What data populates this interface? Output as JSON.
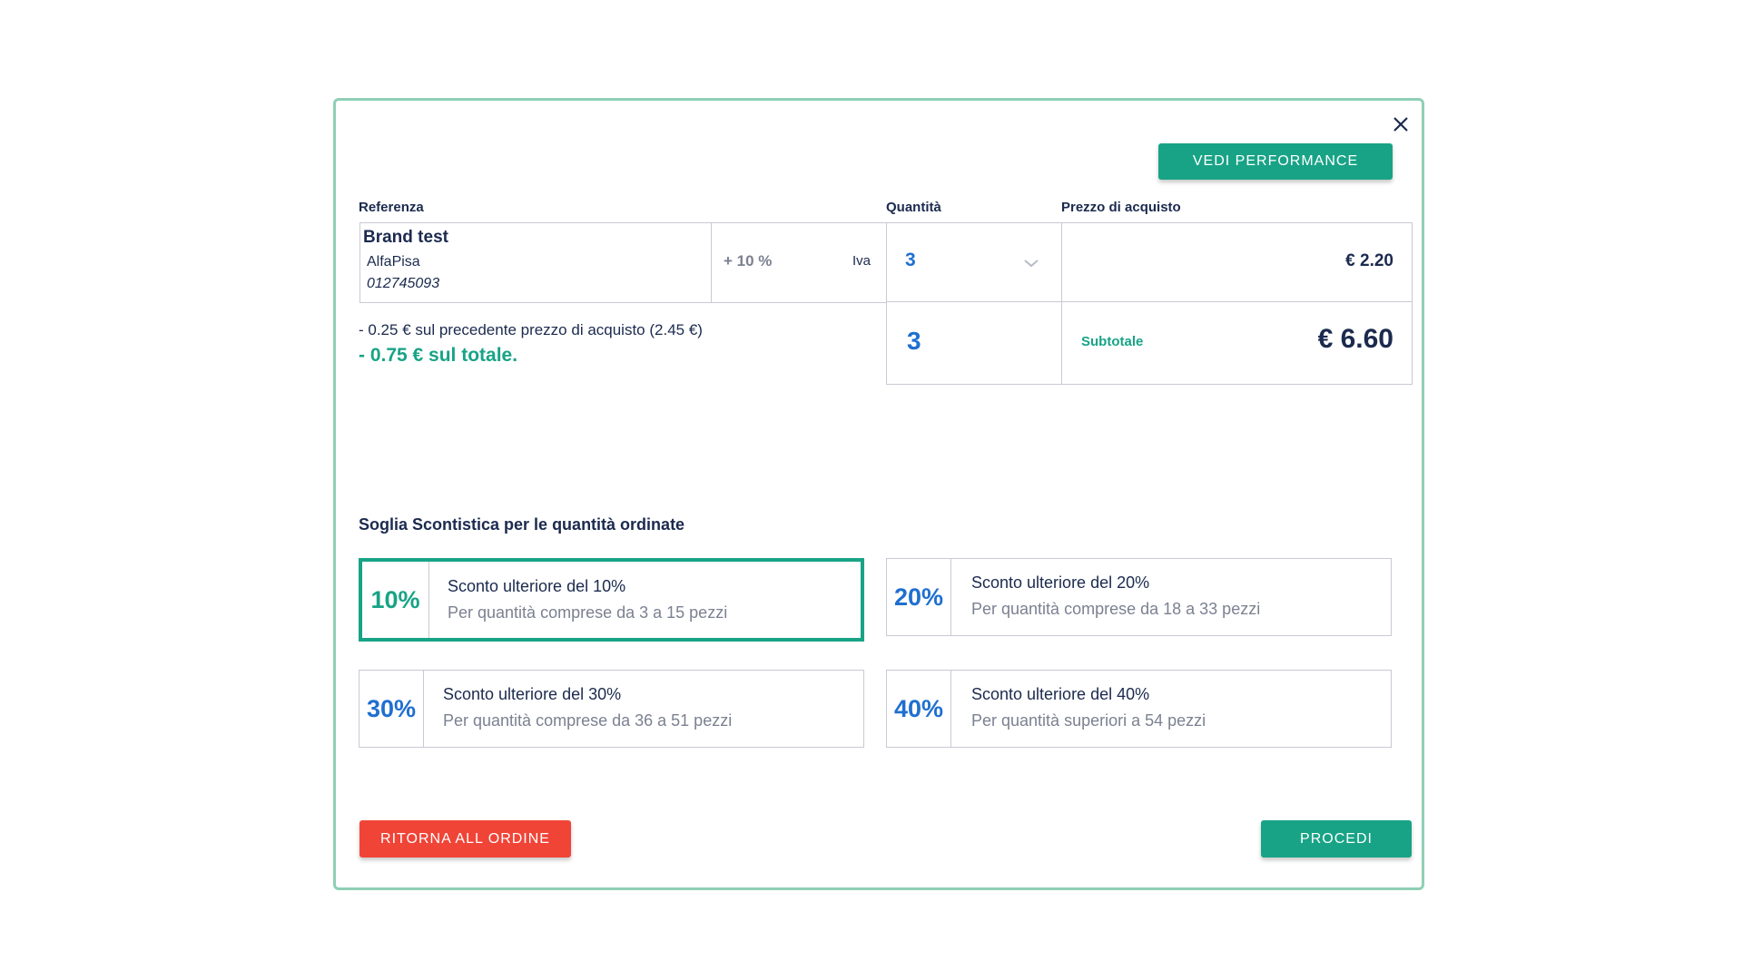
{
  "modal": {
    "close_icon": "close-icon",
    "vedi_performance": "VEDI PERFORMANCE",
    "headers": {
      "referenza": "Referenza",
      "quantita": "Quantità",
      "prezzo": "Prezzo di acquisto"
    },
    "product": {
      "brand": "Brand test",
      "supplier": "AlfaPisa",
      "code": "012745093",
      "markup": "+ 10 %",
      "iva": "Iva",
      "quantity": "3",
      "price": "€ 2.20"
    },
    "savings": {
      "line1": "- 0.25 € sul precedente prezzo di acquisto (2.45 €)",
      "line2": "- 0.75 € sul totale."
    },
    "summary": {
      "quantity": "3",
      "subtotal_label": "Subtotale",
      "subtotal_value": "€ 6.60"
    },
    "tiers_title": "Soglia Scontistica per le quantità ordinate",
    "tiers": [
      {
        "pct": "10%",
        "title": "Sconto ulteriore del 10%",
        "desc": "Per quantità comprese da 3 a 15 pezzi",
        "active": true
      },
      {
        "pct": "20%",
        "title": "Sconto ulteriore del 20%",
        "desc": "Per quantità comprese da 18 a 33 pezzi",
        "active": false
      },
      {
        "pct": "30%",
        "title": "Sconto ulteriore del 30%",
        "desc": "Per quantità comprese da 36 a 51 pezzi",
        "active": false
      },
      {
        "pct": "40%",
        "title": "Sconto ulteriore del 40%",
        "desc": "Per quantità superiori a 54 pezzi",
        "active": false
      }
    ],
    "ritorna": "RITORNA ALL ORDINE",
    "procedi": "PROCEDI"
  },
  "colors": {
    "accent_green": "#18a386",
    "danger_red": "#f04437",
    "quantity_blue": "#1f6fd0",
    "border_green": "#8fcfb6"
  }
}
